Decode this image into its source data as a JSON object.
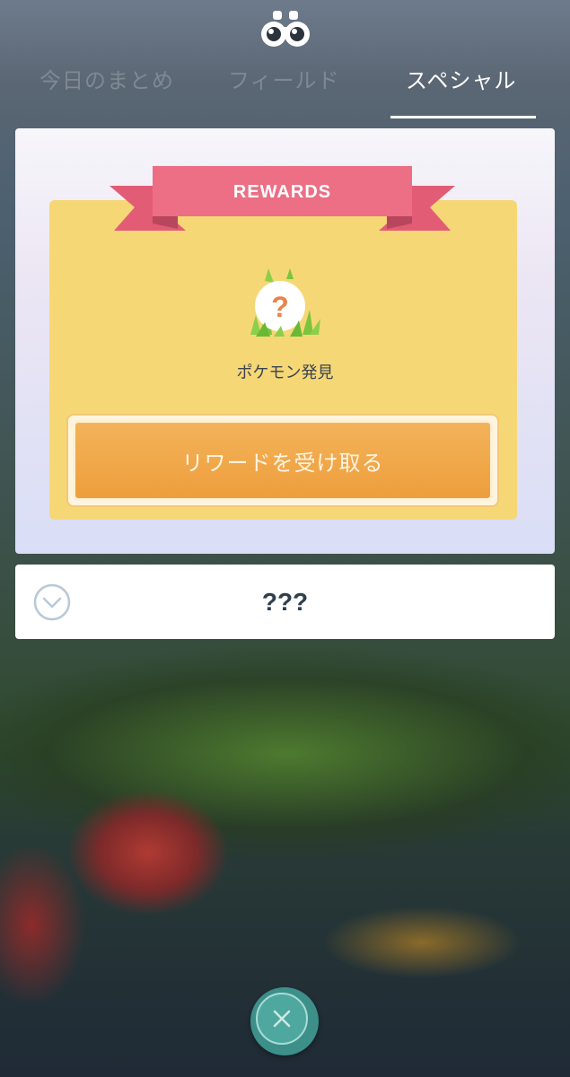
{
  "header": {
    "icon": "binoculars-icon",
    "tabs": [
      {
        "label": "今日のまとめ",
        "active": false
      },
      {
        "label": "フィールド",
        "active": false
      },
      {
        "label": "スペシャル",
        "active": true
      }
    ]
  },
  "reward_card": {
    "ribbon_label": "REWARDS",
    "reward_icon": "question-mark-encounter-icon",
    "reward_label": "ポケモン発見",
    "button_label": "リワードを受け取る"
  },
  "task": {
    "title": "???",
    "icon": "chevron-down-circle-icon"
  },
  "close": {
    "icon": "close-icon"
  },
  "colors": {
    "ribbon": "#ec6f85",
    "reward_box": "#f6d776",
    "button": "#ef9f3d",
    "close_button": "#3d8f8a"
  }
}
